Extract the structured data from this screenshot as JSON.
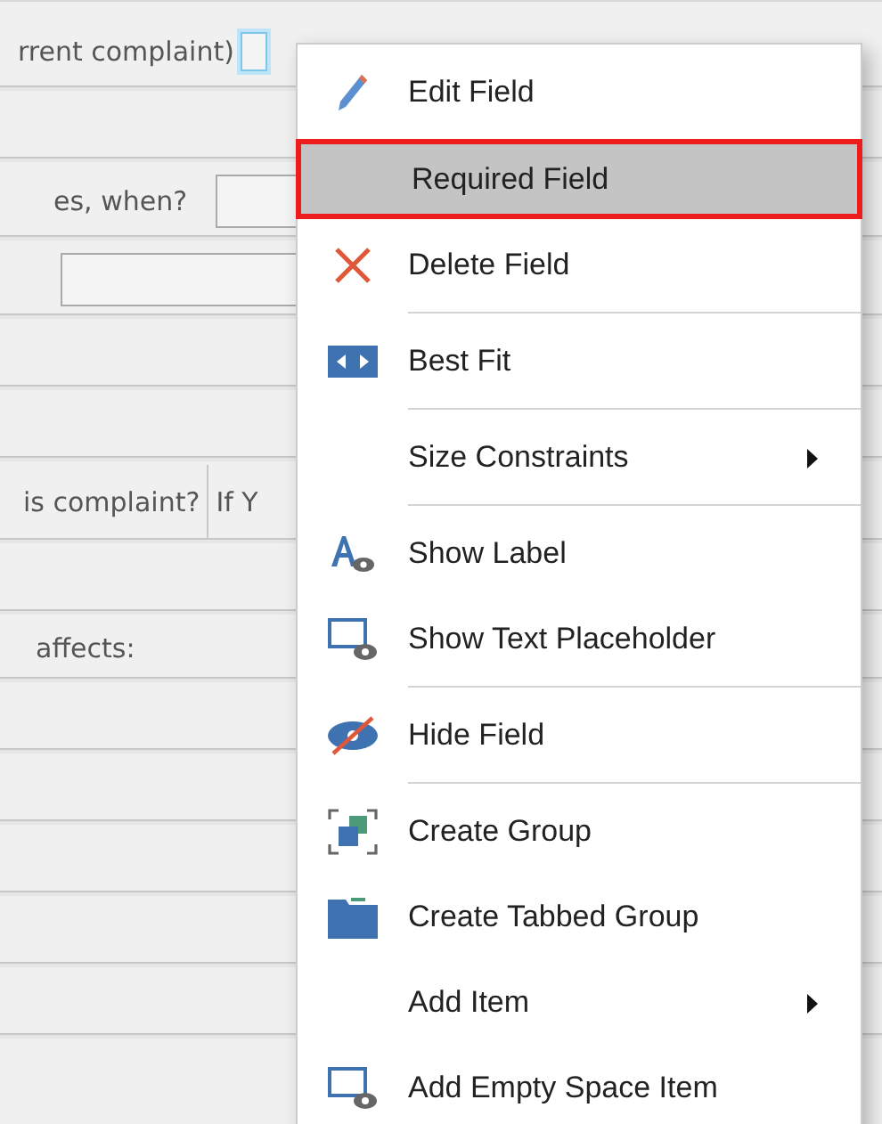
{
  "form": {
    "rows": [
      {
        "kind": "label_check",
        "label": "rrent complaint)",
        "focused": true
      },
      {
        "kind": "blank"
      },
      {
        "kind": "label_input",
        "label": "es, when?"
      },
      {
        "kind": "input"
      },
      {
        "kind": "blank"
      },
      {
        "kind": "blank"
      },
      {
        "kind": "split",
        "label": "is complaint?",
        "label_2": "If Y"
      },
      {
        "kind": "blank"
      },
      {
        "kind": "label",
        "label": "affects:"
      },
      {
        "kind": "blank"
      },
      {
        "kind": "blank"
      },
      {
        "kind": "blank"
      },
      {
        "kind": "blank"
      },
      {
        "kind": "blank"
      }
    ]
  },
  "context_menu": {
    "items": [
      {
        "kind": "item",
        "label": "Edit Field",
        "selected": false,
        "submenu": false
      },
      {
        "kind": "item",
        "label": "Required Field",
        "selected": true,
        "submenu": false
      },
      {
        "kind": "item",
        "label": "Delete Field",
        "selected": false,
        "submenu": false
      },
      {
        "kind": "separator"
      },
      {
        "kind": "item",
        "label": "Best Fit",
        "selected": false,
        "submenu": false
      },
      {
        "kind": "separator"
      },
      {
        "kind": "item",
        "label": "Size Constraints",
        "selected": false,
        "submenu": true
      },
      {
        "kind": "separator"
      },
      {
        "kind": "item",
        "label": "Show Label",
        "selected": false,
        "submenu": false
      },
      {
        "kind": "item",
        "label": "Show Text Placeholder",
        "selected": false,
        "submenu": false
      },
      {
        "kind": "separator"
      },
      {
        "kind": "item",
        "label": "Hide Field",
        "selected": false,
        "submenu": false
      },
      {
        "kind": "separator"
      },
      {
        "kind": "item",
        "label": "Create Group",
        "selected": false,
        "submenu": false
      },
      {
        "kind": "item",
        "label": "Create Tabbed Group",
        "selected": false,
        "submenu": false
      },
      {
        "kind": "item",
        "label": "Add Item",
        "selected": false,
        "submenu": true
      },
      {
        "kind": "item",
        "label": "Add Empty Space Item",
        "selected": false,
        "submenu": false
      }
    ]
  }
}
